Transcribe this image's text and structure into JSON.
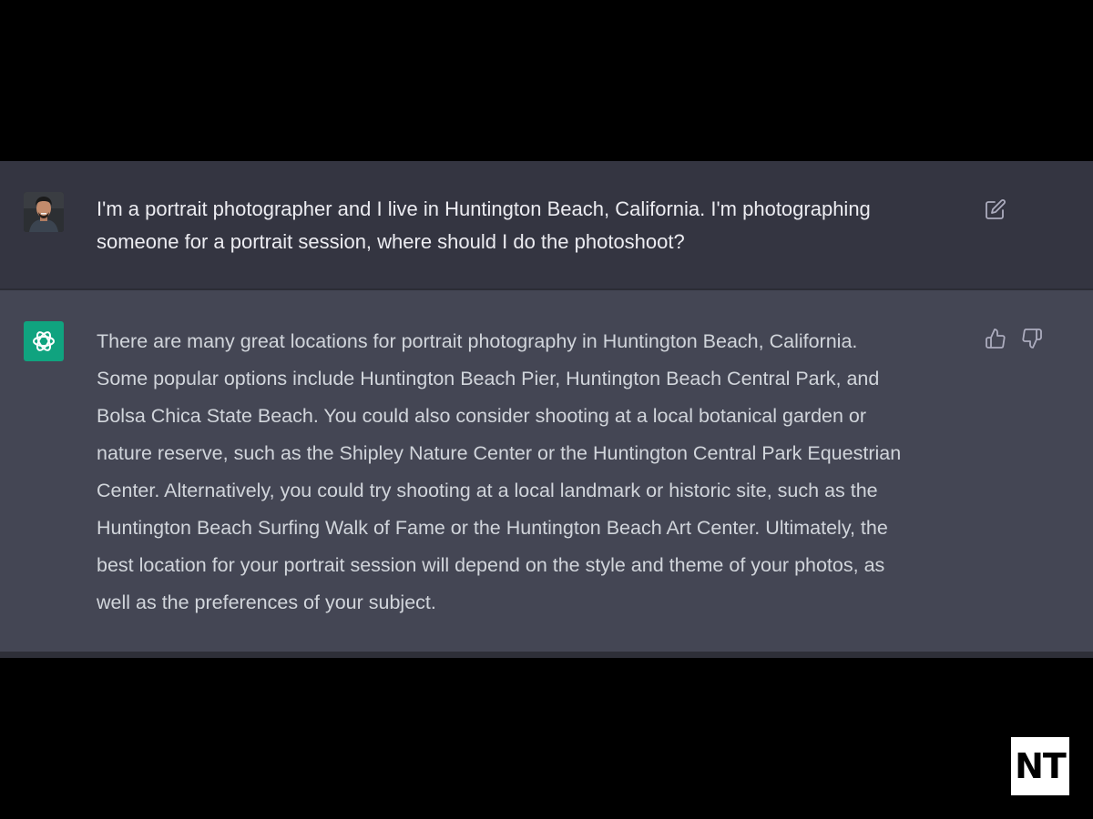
{
  "conversation": {
    "user_message": {
      "text": "I'm a portrait photographer and I live in Huntington Beach, California. I'm photographing\nsomeone for a portrait session, where should I do the photoshoot?",
      "avatar_icon": "user-avatar-photo",
      "edit_icon": "edit-icon"
    },
    "assistant_message": {
      "text": "There are many great locations for portrait photography in Huntington Beach, California.\nSome popular options include Huntington Beach Pier, Huntington Beach Central Park, and\nBolsa Chica State Beach. You could also consider shooting at a local botanical garden or\nnature reserve, such as the Shipley Nature Center or the Huntington Central Park Equestrian\nCenter. Alternatively, you could try shooting at a local landmark or historic site, such as the\nHuntington Beach Surfing Walk of Fame or the Huntington Beach Art Center. Ultimately, the\nbest location for your portrait session will depend on the style and theme of your photos, as\nwell as the preferences of your subject.",
      "avatar_icon": "openai-logo-icon",
      "feedback_icons": [
        "thumbs-up-icon",
        "thumbs-down-icon"
      ]
    }
  },
  "watermark": {
    "text": "NT"
  },
  "colors": {
    "background": "#000000",
    "user_row": "#343541",
    "assistant_row": "#444654",
    "brand_green": "#10a37f",
    "text": "#ececf1",
    "icon": "#acacbe"
  }
}
